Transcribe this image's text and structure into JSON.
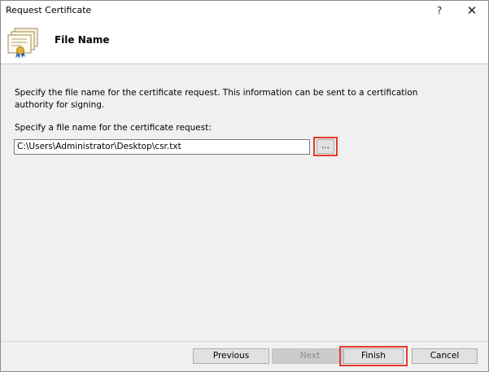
{
  "window": {
    "title": "Request Certificate",
    "help_label": "?",
    "close_label": "✕"
  },
  "header": {
    "title": "File Name"
  },
  "content": {
    "description": "Specify the file name for the certificate request. This information can be sent to a certification authority for signing.",
    "field_label": "Specify a file name for the certificate request:",
    "path_value": "C:\\Users\\Administrator\\Desktop\\csr.txt",
    "browse_label": "..."
  },
  "buttons": {
    "previous": "Previous",
    "next": "Next",
    "finish": "Finish",
    "cancel": "Cancel"
  },
  "colors": {
    "highlight": "#e8392a",
    "window_background": "#f0f0f0",
    "header_background": "#ffffff"
  }
}
